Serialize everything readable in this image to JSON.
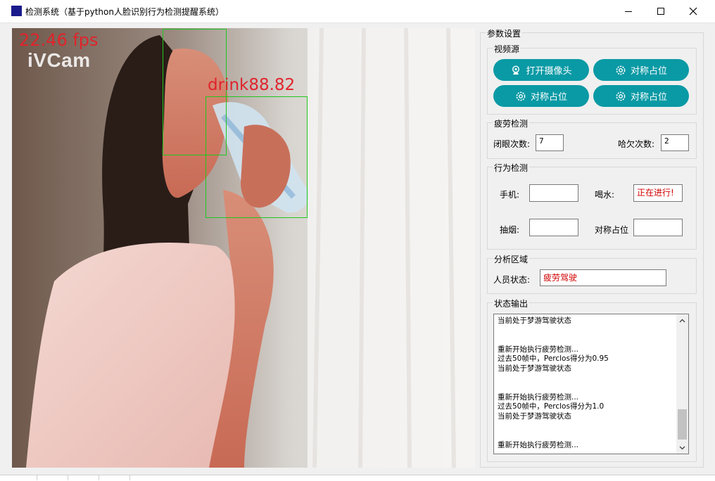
{
  "window": {
    "title": "检测系统（基于python人脸识别行为检测提醒系统）",
    "controls": [
      "minimize-icon",
      "maximize-icon",
      "close-icon"
    ]
  },
  "video": {
    "fps_text": "22.46 fps",
    "watermark": "iVCam",
    "detection_label": "drink88.82"
  },
  "panel": {
    "title": "参数设置",
    "video_source": {
      "title": "视频源",
      "open_camera": "打开摄像头",
      "placeholder_1": "对称占位",
      "placeholder_2": "对称占位",
      "placeholder_3": "对称占位"
    },
    "fatigue": {
      "title": "疲劳检测",
      "eye_close_label": "闭眼次数:",
      "eye_close_value": "7",
      "yawn_label": "哈欠次数:",
      "yawn_value": "2"
    },
    "behavior": {
      "title": "行为检测",
      "phone_label": "手机:",
      "phone_value": "",
      "drink_label": "喝水:",
      "drink_value": "正在进行!",
      "smoke_label": "抽烟:",
      "smoke_value": "",
      "placeholder_label": "对称占位",
      "placeholder_value": ""
    },
    "analysis": {
      "title": "分析区域",
      "status_label": "人员状态:",
      "status_value": "疲劳驾驶"
    },
    "output": {
      "title": "状态输出",
      "log": "当前处于梦游驾驶状态\n\n\n重新开始执行疲劳检测...\n过去50帧中，Perclos得分为0.95\n当前处于梦游驾驶状态\n\n\n重新开始执行疲劳检测...\n过去50帧中，Perclos得分为1.0\n当前处于梦游驾驶状态\n\n\n重新开始执行疲劳检测..."
    }
  },
  "colors": {
    "accent": "#0a9aa5",
    "detection_box": "#1ec81e",
    "overlay_text": "#e0242b",
    "alert_text": "#d10000"
  }
}
